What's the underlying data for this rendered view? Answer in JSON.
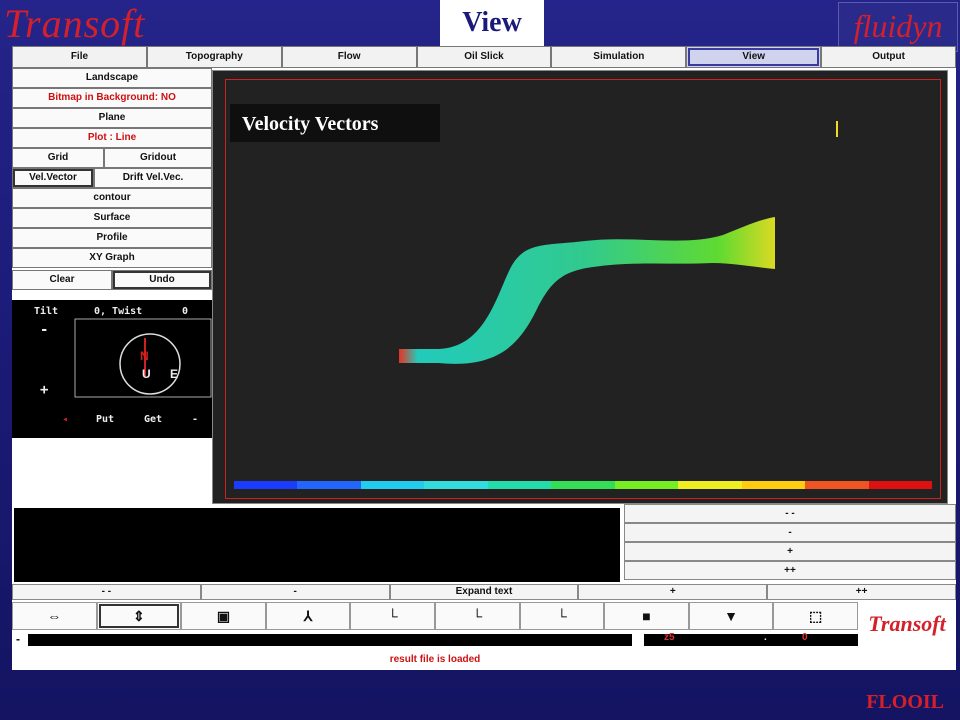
{
  "header": {
    "brand_left": "Transoft",
    "title": "View",
    "brand_right": "fluidyn"
  },
  "menu": [
    {
      "label": "File",
      "active": false
    },
    {
      "label": "Topography",
      "active": false
    },
    {
      "label": "Flow",
      "active": false
    },
    {
      "label": "Oil Slick",
      "active": false
    },
    {
      "label": "Simulation",
      "active": false
    },
    {
      "label": "View",
      "active": true
    },
    {
      "label": "Output",
      "active": false
    }
  ],
  "left": {
    "landscape": "Landscape",
    "bitmap": "Bitmap in Background: NO",
    "plane": "Plane",
    "plot": "Plot : Line",
    "grid": "Grid",
    "gridout": "Gridout",
    "vel_vector": "Vel.Vector",
    "drift": "Drift Vel.Vec.",
    "contour": "contour",
    "surface": "Surface",
    "profile": "Profile",
    "xy_graph": "XY Graph",
    "clear": "Clear",
    "undo": "Undo"
  },
  "orientation": {
    "tilt_label": "Tilt",
    "tilt_value": "0, Twist",
    "twist_value": "0",
    "minus": "-",
    "plus": "+",
    "put": "Put",
    "get": "Get",
    "compass_n": "N",
    "compass_u": "U",
    "compass_e": "E"
  },
  "viewport": {
    "overlay_label": "Velocity Vectors",
    "colorbar": [
      "#1a3cff",
      "#2266ff",
      "#22ccee",
      "#33dddd",
      "#22ddaa",
      "#33dd55",
      "#77ee22",
      "#eeee22",
      "#ffcc11",
      "#ee5522",
      "#dd1111"
    ]
  },
  "steps": [
    "- -",
    "-",
    "+",
    "++"
  ],
  "expand": [
    "- -",
    "-",
    "Expand text",
    "+",
    "++"
  ],
  "toolbar_icons": [
    "pan-icon",
    "move-icon",
    "frame-icon",
    "axes-xyz-icon",
    "axes-xy-icon",
    "axes-zy-icon",
    "axes-zx-icon",
    "fill-black-icon",
    "bucket-icon",
    "cube-icon"
  ],
  "scroll": {
    "left_marker": "-",
    "z_value": "z5",
    "dot": ".",
    "value2": "0"
  },
  "status_text": "result file is loaded",
  "footer": {
    "transoft": "Transoft",
    "app_name": "FLOOIL"
  }
}
